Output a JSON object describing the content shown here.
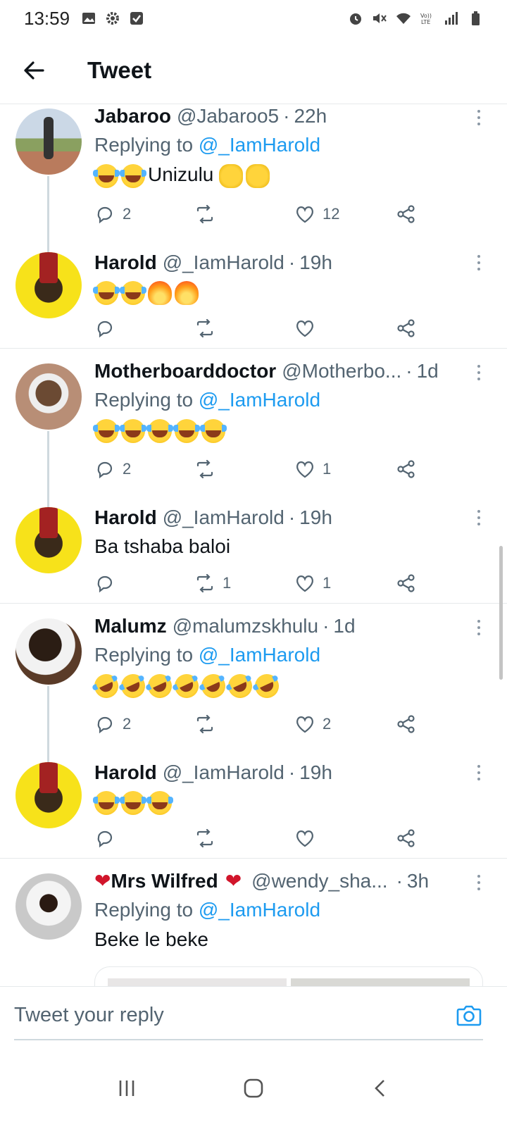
{
  "status_bar": {
    "time": "13:59",
    "left_icons": [
      "image-icon",
      "gear-icon",
      "checkbox-icon"
    ],
    "right_icons": [
      "alarm-icon",
      "mute-icon",
      "wifi-icon",
      "volte-icon",
      "signal-icon",
      "battery-icon"
    ],
    "volte_label": "Vo))\nLTE"
  },
  "header": {
    "title": "Tweet",
    "back_icon": "arrow-left-icon"
  },
  "tweets": [
    {
      "name": "Jabaroo",
      "handle": "@Jabaroo5",
      "time": "22h",
      "replying_prefix": "Replying to",
      "replying_to": "@_IamHarold",
      "text": "Unizulu",
      "emoji_before": [
        "face-with-tears-of-joy",
        "face-with-tears-of-joy"
      ],
      "emoji_after": [
        "clapping-hands",
        "clapping-hands"
      ],
      "reply_count": "2",
      "retweet_count": "",
      "like_count": "12"
    },
    {
      "name": "Harold",
      "handle": "@_IamHarold",
      "time": "19h",
      "text": "",
      "emoji_before": [
        "face-with-tears-of-joy",
        "face-with-tears-of-joy",
        "fire",
        "fire"
      ],
      "reply_count": "",
      "retweet_count": "",
      "like_count": ""
    },
    {
      "name": "Motherboarddoctor",
      "handle": "@Motherbo...",
      "time": "1d",
      "replying_prefix": "Replying to",
      "replying_to": "@_IamHarold",
      "text": "",
      "emoji_before": [
        "face-with-tears-of-joy",
        "face-with-tears-of-joy",
        "face-with-tears-of-joy",
        "face-with-tears-of-joy",
        "face-with-tears-of-joy"
      ],
      "reply_count": "2",
      "retweet_count": "",
      "like_count": "1"
    },
    {
      "name": "Harold",
      "handle": "@_IamHarold",
      "time": "19h",
      "text": "Ba tshaba baloi",
      "reply_count": "",
      "retweet_count": "1",
      "like_count": "1"
    },
    {
      "name": "Malumz",
      "handle": "@malumzskhulu",
      "time": "1d",
      "replying_prefix": "Replying to",
      "replying_to": "@_IamHarold",
      "text": "",
      "emoji_before": [
        "rolling-on-floor-laughing",
        "rolling-on-floor-laughing",
        "rolling-on-floor-laughing",
        "rolling-on-floor-laughing",
        "rolling-on-floor-laughing",
        "rolling-on-floor-laughing",
        "rolling-on-floor-laughing"
      ],
      "reply_count": "2",
      "retweet_count": "",
      "like_count": "2"
    },
    {
      "name": "Harold",
      "handle": "@_IamHarold",
      "time": "19h",
      "text": "",
      "emoji_before": [
        "face-with-tears-of-joy",
        "face-with-tears-of-joy",
        "face-with-tears-of-joy"
      ],
      "reply_count": "",
      "retweet_count": "",
      "like_count": ""
    },
    {
      "name": "Mrs Wilfred",
      "name_prefix_heart": "❤",
      "name_suffix_heart": "❤",
      "handle": "@wendy_sha...",
      "time": "3h",
      "replying_prefix": "Replying to",
      "replying_to": "@_IamHarold",
      "text": "Beke le beke"
    }
  ],
  "reply_bar": {
    "placeholder": "Tweet your reply",
    "camera_icon": "camera-icon"
  },
  "nav_bar": {
    "icons": [
      "recent-apps-icon",
      "home-icon",
      "back-icon"
    ]
  },
  "colors": {
    "accent": "#1d9bf0",
    "secondary_text": "#536471",
    "divider": "#e6e9eb",
    "thread_line": "#cfd9de"
  }
}
